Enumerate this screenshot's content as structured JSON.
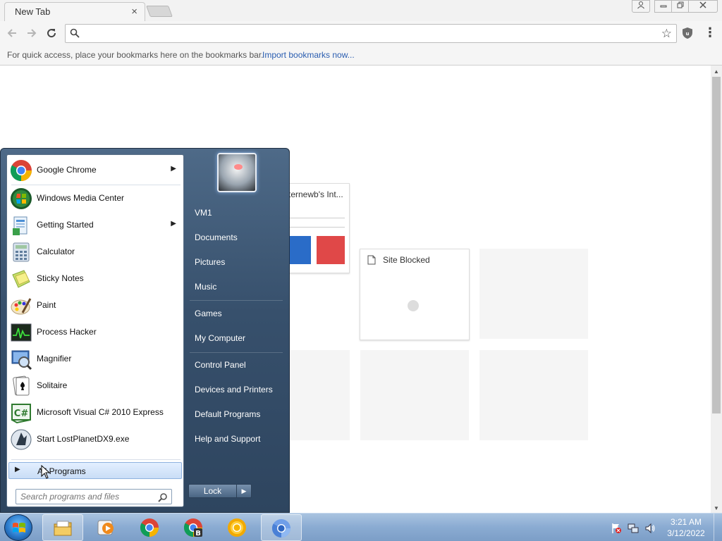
{
  "browser": {
    "tab_title": "New Tab",
    "tab_close": "×",
    "omnibox_value": "",
    "bookmarks_bar_text": "For quick access, place your bookmarks here on the bookmarks bar.",
    "import_bookmarks_link": "Import bookmarks now...",
    "icons": {
      "back": "arrow-left-icon",
      "forward": "arrow-right-icon",
      "reload": "reload-icon",
      "search": "search-icon",
      "star": "star-icon",
      "extension": "ublock-shield-icon",
      "menu": "three-dot-menu-icon"
    }
  },
  "most_visited": [
    {
      "title": "ternewb's Int..."
    },
    {
      "title": "Site Blocked"
    }
  ],
  "start_menu": {
    "pinned_programs": [
      {
        "label": "Google Chrome",
        "icon": "chrome-icon",
        "has_submenu": true
      },
      {
        "label": "Windows Media Center",
        "icon": "windows-media-center-icon",
        "has_submenu": false
      },
      {
        "label": "Getting Started",
        "icon": "getting-started-icon",
        "has_submenu": true
      },
      {
        "label": "Calculator",
        "icon": "calculator-icon",
        "has_submenu": false
      },
      {
        "label": "Sticky Notes",
        "icon": "sticky-notes-icon",
        "has_submenu": false
      },
      {
        "label": "Paint",
        "icon": "paint-icon",
        "has_submenu": false
      },
      {
        "label": "Process Hacker",
        "icon": "process-hacker-icon",
        "has_submenu": false
      },
      {
        "label": "Magnifier",
        "icon": "magnifier-icon",
        "has_submenu": false
      },
      {
        "label": "Solitaire",
        "icon": "solitaire-icon",
        "has_submenu": false
      },
      {
        "label": "Microsoft Visual C# 2010 Express",
        "icon": "visual-csharp-icon",
        "has_submenu": false
      },
      {
        "label": "Start LostPlanetDX9.exe",
        "icon": "lost-planet-icon",
        "has_submenu": false
      }
    ],
    "all_programs": "All Programs",
    "search_placeholder": "Search programs and files",
    "right_pane": [
      "VM1",
      "Documents",
      "Pictures",
      "Music",
      "Games",
      "My Computer",
      "Control Panel",
      "Devices and Printers",
      "Default Programs",
      "Help and Support"
    ],
    "lock_label": "Lock",
    "lock_arrow": "▶"
  },
  "taskbar": {
    "time": "3:21 AM",
    "date": "3/12/2022",
    "pinned": [
      "windows-explorer-icon",
      "media-player-icon",
      "chrome-icon",
      "chrome-b-icon",
      "chrome-canary-icon",
      "chromium-icon"
    ]
  },
  "colors": {
    "start_menu_bg": "#3a5572",
    "taskbar_bg": "#8aabd2",
    "link": "#2a5db0",
    "chrome_red": "#db4437",
    "chrome_green": "#0f9d58",
    "chrome_yellow": "#f4b400",
    "chrome_blue": "#4285f4"
  }
}
